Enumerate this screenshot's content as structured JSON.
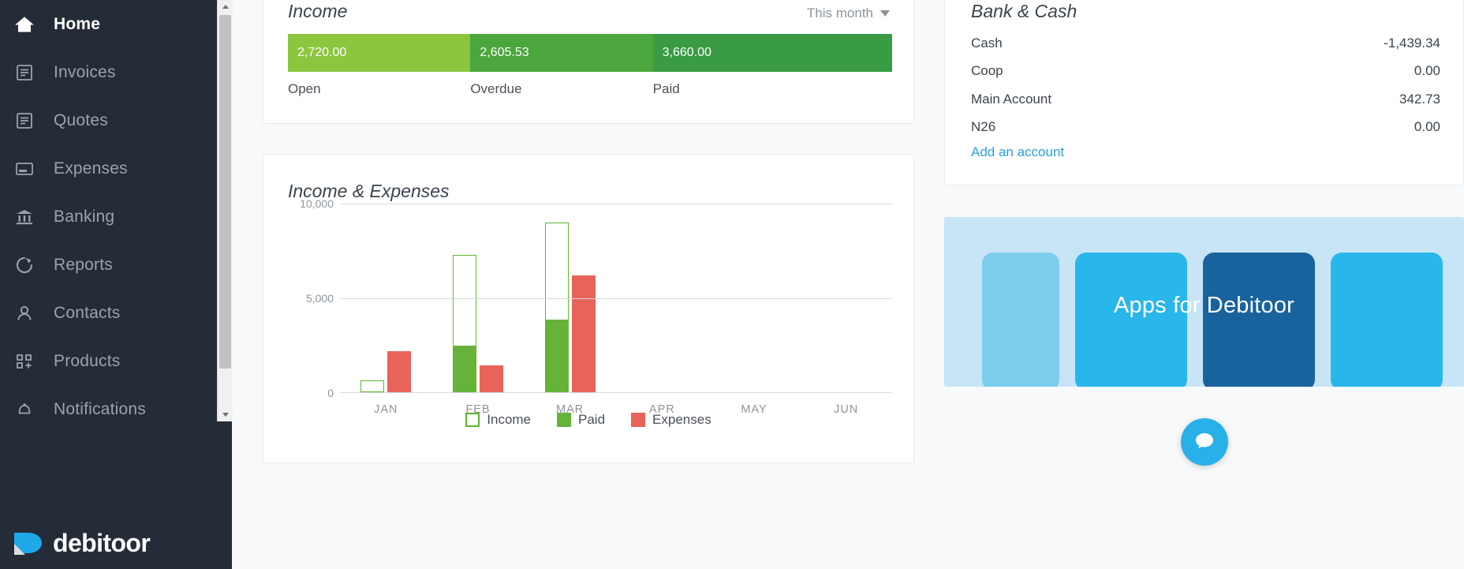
{
  "sidebar": {
    "items": [
      {
        "label": "Home",
        "icon": "home-icon",
        "active": true
      },
      {
        "label": "Invoices",
        "icon": "invoice-icon",
        "active": false
      },
      {
        "label": "Quotes",
        "icon": "quote-icon",
        "active": false
      },
      {
        "label": "Expenses",
        "icon": "expense-icon",
        "active": false
      },
      {
        "label": "Banking",
        "icon": "bank-icon",
        "active": false
      },
      {
        "label": "Reports",
        "icon": "pie-chart-icon",
        "active": false
      },
      {
        "label": "Contacts",
        "icon": "person-icon",
        "active": false
      },
      {
        "label": "Products",
        "icon": "products-grid-icon",
        "active": false
      },
      {
        "label": "Notifications",
        "icon": "bell-icon",
        "active": false
      }
    ],
    "brand": "debitoor"
  },
  "income": {
    "title": "Income",
    "period": "This month",
    "segments": [
      {
        "label": "Open",
        "value": "2,720.00",
        "color": "#8cc63e",
        "width_pct": 30.2
      },
      {
        "label": "Overdue",
        "value": "2,605.53",
        "color": "#4ba63d",
        "width_pct": 30.2
      },
      {
        "label": "Paid",
        "value": "3,660.00",
        "color": "#399b43",
        "width_pct": 39.6
      }
    ]
  },
  "chart_data": {
    "type": "bar",
    "title": "Income & Expenses",
    "xlabel": "",
    "ylabel": "",
    "ylim": [
      0,
      10000
    ],
    "yticks": [
      0,
      5000,
      10000
    ],
    "ytick_labels": [
      "0",
      "5,000",
      "10,000"
    ],
    "grid": true,
    "legend_position": "bottom",
    "categories": [
      "JAN",
      "FEB",
      "MAR",
      "APR",
      "MAY",
      "JUN"
    ],
    "series": [
      {
        "name": "Income",
        "values": [
          640,
          7250,
          8960,
          0,
          0,
          0
        ]
      },
      {
        "name": "Paid",
        "values": [
          0,
          2400,
          3780,
          0,
          0,
          0
        ]
      },
      {
        "name": "Expenses",
        "values": [
          2180,
          1420,
          6160,
          0,
          0,
          0
        ]
      }
    ],
    "colors": {
      "income": "#5cb531",
      "paid": "#67b339",
      "expenses": "#e8635a"
    }
  },
  "bank": {
    "title": "Bank & Cash",
    "rows": [
      {
        "name": "Cash",
        "amount": "-1,439.34"
      },
      {
        "name": "Coop",
        "amount": "0.00"
      },
      {
        "name": "Main Account",
        "amount": "342.73"
      },
      {
        "name": "N26",
        "amount": "0.00"
      }
    ],
    "add_account": "Add an account"
  },
  "apps_banner": {
    "text": "Apps for Debitoor"
  },
  "chat": {
    "icon": "chat-bubble-icon"
  },
  "colors": {
    "sidebar_bg": "#242c38",
    "accent_link": "#2d9fdb",
    "green_light": "#8cc63e",
    "green_mid": "#4ba63d",
    "green_dark": "#399b43",
    "red": "#e8635a",
    "blue": "#29b0e8"
  }
}
